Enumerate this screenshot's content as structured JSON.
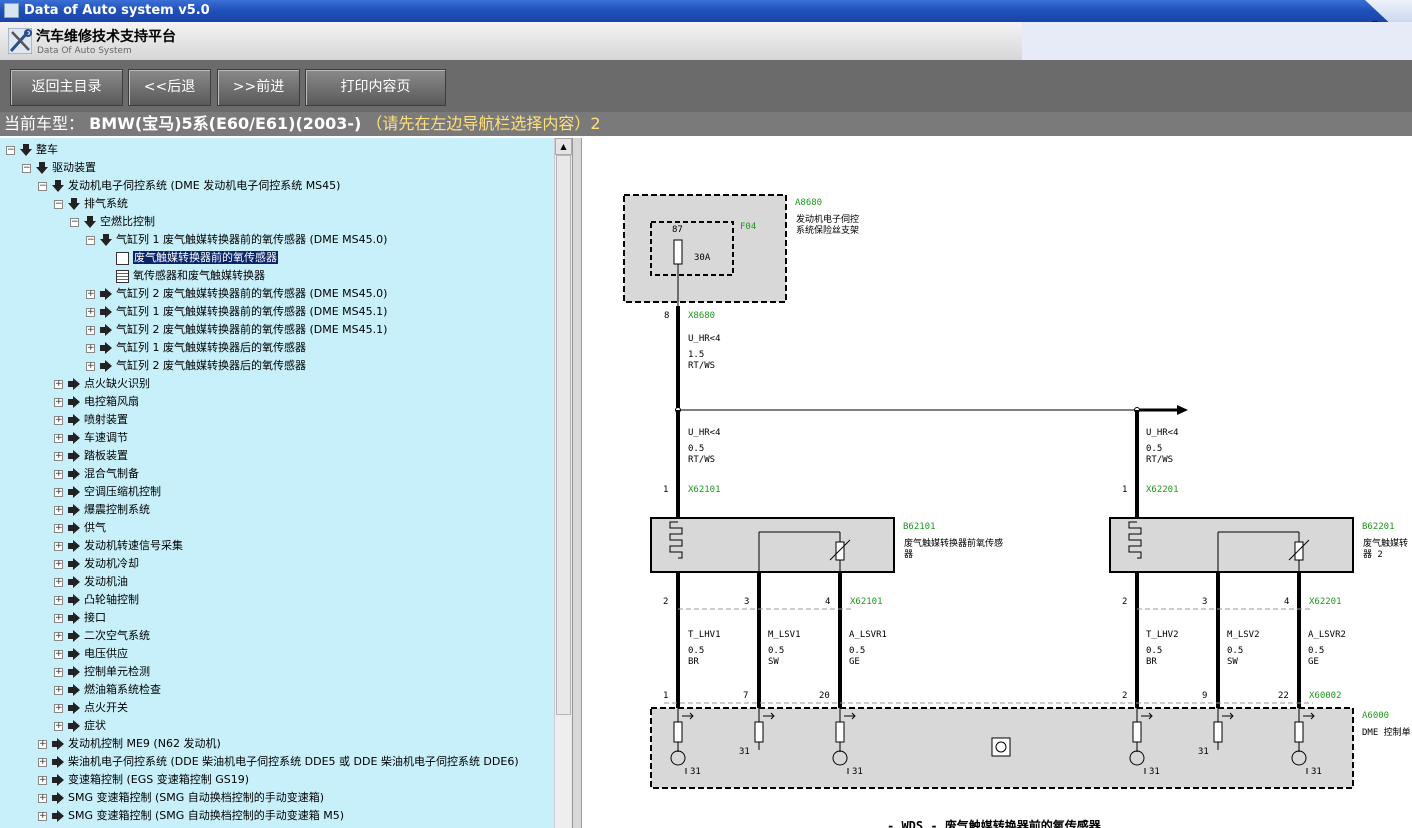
{
  "window": {
    "title": "Data of Auto system v5.0",
    "minimize": "_"
  },
  "brand": {
    "name": "汽车维修技术支持平台",
    "subtitle": "Data Of Auto System"
  },
  "toolbar": {
    "home": "返回主目录",
    "back": "<<后退",
    "forward": ">>前进",
    "print": "打印内容页"
  },
  "current_vehicle": {
    "label": "当前车型：",
    "model": "BMW(宝马)5系(E60/E61)(2003-)",
    "hint": "（请先在左边导航栏选择内容）2"
  },
  "tree": [
    {
      "text": "整车",
      "level": 0,
      "state": "open",
      "icon": "arrow-down"
    },
    {
      "text": "驱动装置",
      "level": 1,
      "state": "open",
      "icon": "arrow-down"
    },
    {
      "text": "发动机电子伺控系统 (DME 发动机电子伺控系统 MS45)",
      "level": 2,
      "state": "open",
      "icon": "arrow-down"
    },
    {
      "text": "排气系统",
      "level": 3,
      "state": "open",
      "icon": "arrow-down"
    },
    {
      "text": "空燃比控制",
      "level": 4,
      "state": "open",
      "icon": "arrow-down"
    },
    {
      "text": "气缸列 1 废气触媒转换器前的氧传感器 (DME MS45.0)",
      "level": 5,
      "state": "open",
      "icon": "arrow-down"
    },
    {
      "text": "废气触媒转换器前的氧传感器",
      "level": 6,
      "state": "leaf",
      "icon": "diagram-doc",
      "selected": true
    },
    {
      "text": "氧传感器和废气触媒转换器",
      "level": 6,
      "state": "leaf",
      "icon": "text-doc"
    },
    {
      "text": "气缸列 2 废气触媒转换器前的氧传感器 (DME MS45.0)",
      "level": 5,
      "state": "closed",
      "icon": "arrow-right"
    },
    {
      "text": "气缸列 1 废气触媒转换器前的氧传感器 (DME MS45.1)",
      "level": 5,
      "state": "closed",
      "icon": "arrow-right"
    },
    {
      "text": "气缸列 2 废气触媒转换器前的氧传感器 (DME MS45.1)",
      "level": 5,
      "state": "closed",
      "icon": "arrow-right"
    },
    {
      "text": "气缸列 1 废气触媒转换器后的氧传感器",
      "level": 5,
      "state": "closed",
      "icon": "arrow-right"
    },
    {
      "text": "气缸列 2 废气触媒转换器后的氧传感器",
      "level": 5,
      "state": "closed",
      "icon": "arrow-right"
    },
    {
      "text": "点火缺火识别",
      "level": 3,
      "state": "closed",
      "icon": "arrow-right"
    },
    {
      "text": "电控箱风扇",
      "level": 3,
      "state": "closed",
      "icon": "arrow-right"
    },
    {
      "text": "喷射装置",
      "level": 3,
      "state": "closed",
      "icon": "arrow-right"
    },
    {
      "text": "车速调节",
      "level": 3,
      "state": "closed",
      "icon": "arrow-right"
    },
    {
      "text": "踏板装置",
      "level": 3,
      "state": "closed",
      "icon": "arrow-right"
    },
    {
      "text": "混合气制备",
      "level": 3,
      "state": "closed",
      "icon": "arrow-right"
    },
    {
      "text": "空调压缩机控制",
      "level": 3,
      "state": "closed",
      "icon": "arrow-right"
    },
    {
      "text": "爆震控制系统",
      "level": 3,
      "state": "closed",
      "icon": "arrow-right"
    },
    {
      "text": "供气",
      "level": 3,
      "state": "closed",
      "icon": "arrow-right"
    },
    {
      "text": "发动机转速信号采集",
      "level": 3,
      "state": "closed",
      "icon": "arrow-right"
    },
    {
      "text": "发动机冷却",
      "level": 3,
      "state": "closed",
      "icon": "arrow-right"
    },
    {
      "text": "发动机油",
      "level": 3,
      "state": "closed",
      "icon": "arrow-right"
    },
    {
      "text": "凸轮轴控制",
      "level": 3,
      "state": "closed",
      "icon": "arrow-right"
    },
    {
      "text": "接口",
      "level": 3,
      "state": "closed",
      "icon": "arrow-right"
    },
    {
      "text": "二次空气系统",
      "level": 3,
      "state": "closed",
      "icon": "arrow-right"
    },
    {
      "text": "电压供应",
      "level": 3,
      "state": "closed",
      "icon": "arrow-right"
    },
    {
      "text": "控制单元检测",
      "level": 3,
      "state": "closed",
      "icon": "arrow-right"
    },
    {
      "text": "燃油箱系统检查",
      "level": 3,
      "state": "closed",
      "icon": "arrow-right"
    },
    {
      "text": "点火开关",
      "level": 3,
      "state": "closed",
      "icon": "arrow-right"
    },
    {
      "text": "症状",
      "level": 3,
      "state": "closed",
      "icon": "arrow-right"
    },
    {
      "text": "发动机控制 ME9 (N62 发动机)",
      "level": 2,
      "state": "closed",
      "icon": "arrow-right"
    },
    {
      "text": "柴油机电子伺控系统 (DDE 柴油机电子伺控系统 DDE5 或 DDE 柴油机电子伺控系统 DDE6)",
      "level": 2,
      "state": "closed",
      "icon": "arrow-right"
    },
    {
      "text": "变速箱控制 (EGS 变速箱控制 GS19)",
      "level": 2,
      "state": "closed",
      "icon": "arrow-right"
    },
    {
      "text": "SMG 变速箱控制 (SMG 自动换档控制的手动变速箱)",
      "level": 2,
      "state": "closed",
      "icon": "arrow-right"
    },
    {
      "text": "SMG 变速箱控制 (SMG 自动换档控制的手动变速箱 M5)",
      "level": 2,
      "state": "closed",
      "icon": "arrow-right"
    }
  ],
  "diagram": {
    "fuse_holder": {
      "id": "A8680",
      "desc1": "发动机电子伺控",
      "desc2": "系统保险丝支架"
    },
    "fuse": {
      "id": "F04",
      "pin": "87",
      "rating": "30A"
    },
    "conn_x8680": {
      "pin": "8",
      "id": "X8680"
    },
    "wire_main": {
      "signal": "U_HR<4",
      "size": "1.5",
      "color": "RT/WS"
    },
    "wire_left": {
      "signal": "U_HR<4",
      "size": "0.5",
      "color": "RT/WS"
    },
    "wire_right": {
      "signal": "U_HR<4",
      "size": "0.5",
      "color": "RT/WS"
    },
    "conn_x62101_top": {
      "pin": "1",
      "id": "X62101"
    },
    "conn_x62201_top": {
      "pin": "1",
      "id": "X62201"
    },
    "sensor_left": {
      "id": "B62101",
      "desc1": "废气触媒转换器前氧传感",
      "desc2": "器"
    },
    "sensor_right": {
      "id": "B62201",
      "desc1": "废气触媒转",
      "desc2": "器 2"
    },
    "left_pins": {
      "p2": "2",
      "p3": "3",
      "p4": "4",
      "id": "X62101"
    },
    "right_pins": {
      "p2": "2",
      "p3": "3",
      "p4": "4",
      "id": "X62201"
    },
    "left_wires": [
      {
        "signal": "T_LHV1",
        "size": "0.5",
        "color": "BR"
      },
      {
        "signal": "M_LSV1",
        "size": "0.5",
        "color": "SW"
      },
      {
        "signal": "A_LSVR1",
        "size": "0.5",
        "color": "GE"
      }
    ],
    "right_wires": [
      {
        "signal": "T_LHV2",
        "size": "0.5",
        "color": "BR"
      },
      {
        "signal": "M_LSV2",
        "size": "0.5",
        "color": "SW"
      },
      {
        "signal": "A_LSVR2",
        "size": "0.5",
        "color": "GE"
      }
    ],
    "dme_pins": {
      "p1": "1",
      "p7": "7",
      "p20": "20",
      "p2": "2",
      "p9": "9",
      "p22": "22",
      "id": "X60002"
    },
    "dme": {
      "id": "A6000",
      "desc": "DME 控制单"
    },
    "ground": "31",
    "caption": "- WDS - 废气触媒转换器前的氧传感器"
  }
}
